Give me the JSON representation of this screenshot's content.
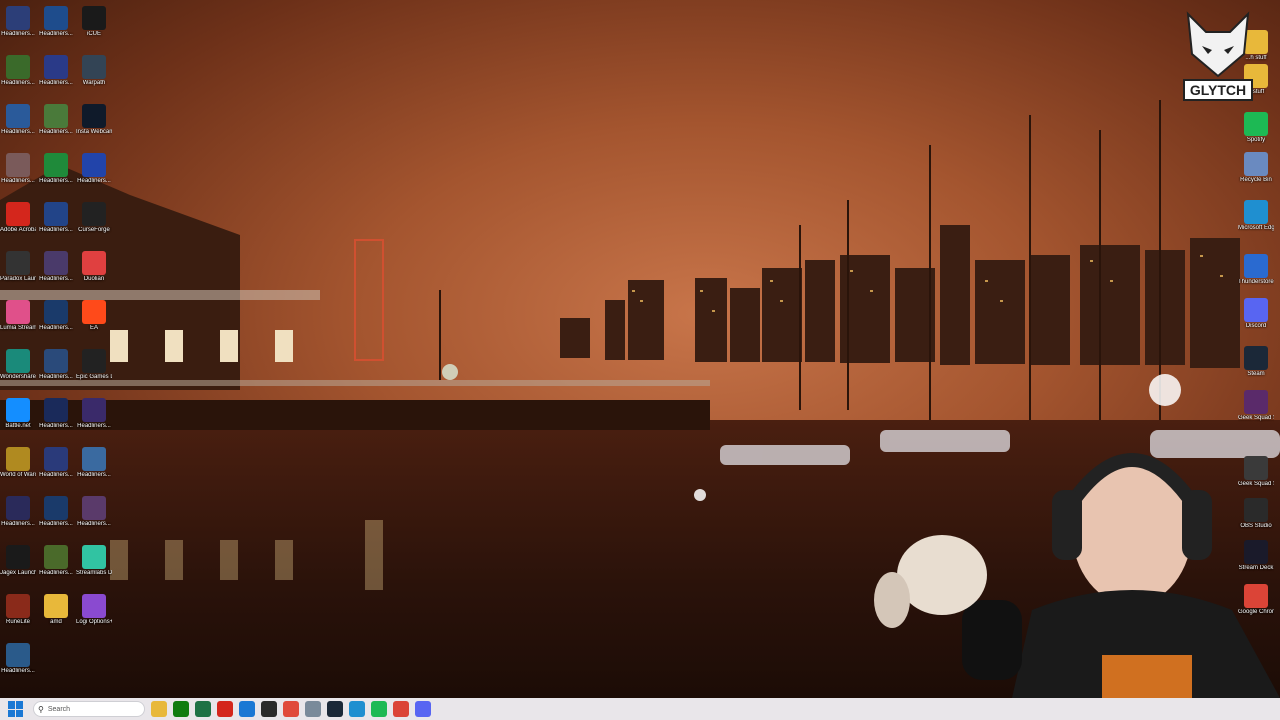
{
  "desktop_left": [
    {
      "label": "Headliners...",
      "icon": "image-file-icon",
      "color": "#2c3e78"
    },
    {
      "label": "Headliners...",
      "icon": "image-file-icon",
      "color": "#1e4c8c"
    },
    {
      "label": "iCUE",
      "icon": "icue-icon",
      "color": "#1a1a1a"
    },
    {
      "label": "Headliners...",
      "icon": "image-file-icon",
      "color": "#3a6a2a"
    },
    {
      "label": "Headliners...",
      "icon": "image-file-icon",
      "color": "#2a3a88"
    },
    {
      "label": "Warpath",
      "icon": "warpath-icon",
      "color": "#334455"
    },
    {
      "label": "Headliners...",
      "icon": "image-file-icon",
      "color": "#2a5a9a"
    },
    {
      "label": "Headliners...",
      "icon": "image-file-icon",
      "color": "#4a7a3a"
    },
    {
      "label": "Insta Webcam",
      "icon": "webcam-icon",
      "color": "#0f1a2a"
    },
    {
      "label": "Headliners...",
      "icon": "image-file-icon",
      "color": "#7a5a5a"
    },
    {
      "label": "Headliners...",
      "icon": "image-file-icon",
      "color": "#1f8a3a"
    },
    {
      "label": "Headliners...",
      "icon": "image-file-icon",
      "color": "#2244aa"
    },
    {
      "label": "Adobe Acrobat",
      "icon": "acrobat-icon",
      "color": "#d4261c"
    },
    {
      "label": "Headliners...",
      "icon": "image-file-icon",
      "color": "#224488"
    },
    {
      "label": "CurseForge",
      "icon": "curseforge-icon",
      "color": "#222222"
    },
    {
      "label": "Paradox Launcher v2",
      "icon": "paradox-icon",
      "color": "#333333"
    },
    {
      "label": "Headliners...",
      "icon": "image-file-icon",
      "color": "#4a3a6a"
    },
    {
      "label": "Duolian",
      "icon": "app-icon",
      "color": "#e04040"
    },
    {
      "label": "Lumia Stream",
      "icon": "lumia-icon",
      "color": "#e0508a"
    },
    {
      "label": "Headliners...",
      "icon": "image-file-icon",
      "color": "#1a3a6a"
    },
    {
      "label": "EA",
      "icon": "ea-icon",
      "color": "#ff4a1a"
    },
    {
      "label": "Wondershare Filmora 14",
      "icon": "filmora-icon",
      "color": "#1a8a7a"
    },
    {
      "label": "Headliners...",
      "icon": "image-file-icon",
      "color": "#2a4a7a"
    },
    {
      "label": "Epic Games Launcher",
      "icon": "epic-icon",
      "color": "#222222"
    },
    {
      "label": "Battle.net",
      "icon": "battlenet-icon",
      "color": "#148eff"
    },
    {
      "label": "Headliners...",
      "icon": "image-file-icon",
      "color": "#1a2a5a"
    },
    {
      "label": "Headliners...",
      "icon": "image-file-icon",
      "color": "#3a2a6a"
    },
    {
      "label": "World of Warcraft",
      "icon": "wow-icon",
      "color": "#b08a20"
    },
    {
      "label": "Headliners...",
      "icon": "image-file-icon",
      "color": "#2a3a7a"
    },
    {
      "label": "Headliners...",
      "icon": "image-file-icon",
      "color": "#3a6aa0"
    },
    {
      "label": "Headliners...",
      "icon": "image-file-icon",
      "color": "#2a2a5a"
    },
    {
      "label": "Headliners...",
      "icon": "image-file-icon",
      "color": "#1a3a6a"
    },
    {
      "label": "Headliners...",
      "icon": "image-file-icon",
      "color": "#5a3a6a"
    },
    {
      "label": "Jagex Launcher",
      "icon": "jagex-icon",
      "color": "#1a1a1a"
    },
    {
      "label": "Headliners...",
      "icon": "image-file-icon",
      "color": "#4a6a2a"
    },
    {
      "label": "Streamlabs Desktop",
      "icon": "streamlabs-icon",
      "color": "#31c3a2"
    },
    {
      "label": "RuneLite",
      "icon": "runelite-icon",
      "color": "#8a2a1a"
    },
    {
      "label": "amd",
      "icon": "folder-icon",
      "color": "#e8b83a"
    },
    {
      "label": "Logi Options+",
      "icon": "logi-icon",
      "color": "#8a4ad0"
    },
    {
      "label": "Headliners...",
      "icon": "image-file-icon",
      "color": "#2a5a8a"
    }
  ],
  "desktop_right": [
    {
      "label": "...h stuff",
      "icon": "folder-icon",
      "color": "#e8b83a"
    },
    {
      "label": "...stuff",
      "icon": "folder-icon",
      "color": "#e8b83a"
    },
    {
      "label": "Spotify",
      "icon": "spotify-icon",
      "color": "#1db954"
    },
    {
      "label": "Recycle Bin",
      "icon": "recycle-bin-icon",
      "color": "#6a8ac0"
    },
    {
      "label": "Microsoft Edge",
      "icon": "edge-icon",
      "color": "#1f8fd0"
    },
    {
      "label": "Thunderstore Mod Mana...",
      "icon": "thunderstore-icon",
      "color": "#2a6ad0"
    },
    {
      "label": "Discord",
      "icon": "discord-icon",
      "color": "#5865f2"
    },
    {
      "label": "Steam",
      "icon": "steam-icon",
      "color": "#1b2838"
    },
    {
      "label": "Geek Squad Shortcut",
      "icon": "geeksquad-icon",
      "color": "#5a2a6a"
    },
    {
      "label": "Geek Squad Support.exe",
      "icon": "geeksquad-icon",
      "color": "#3a3a3a"
    },
    {
      "label": "OBS Studio",
      "icon": "obs-icon",
      "color": "#2a2a2a"
    },
    {
      "label": "Stream Deck",
      "icon": "streamdeck-icon",
      "color": "#1a1a2a"
    },
    {
      "label": "Google Chrome",
      "icon": "chrome-icon",
      "color": "#db4437"
    }
  ],
  "logo": {
    "text": "GLYTCH"
  },
  "taskbar": {
    "search_placeholder": "Search",
    "icons": [
      {
        "name": "file-explorer-icon",
        "color": "#e8b83a"
      },
      {
        "name": "xbox-icon",
        "color": "#107c10"
      },
      {
        "name": "excel-icon",
        "color": "#1e7145"
      },
      {
        "name": "acrobat-icon",
        "color": "#d4261c"
      },
      {
        "name": "calculator-icon",
        "color": "#1a78d4"
      },
      {
        "name": "obs-icon",
        "color": "#2a2a2a"
      },
      {
        "name": "paint-icon",
        "color": "#e04a3a"
      },
      {
        "name": "chrome-canary-icon",
        "color": "#7a8a9a"
      },
      {
        "name": "steam-icon",
        "color": "#1b2838"
      },
      {
        "name": "edge-icon",
        "color": "#1f8fd0"
      },
      {
        "name": "spotify-icon",
        "color": "#1db954"
      },
      {
        "name": "chrome-icon",
        "color": "#db4437"
      },
      {
        "name": "discord-icon",
        "color": "#5865f2"
      }
    ]
  }
}
